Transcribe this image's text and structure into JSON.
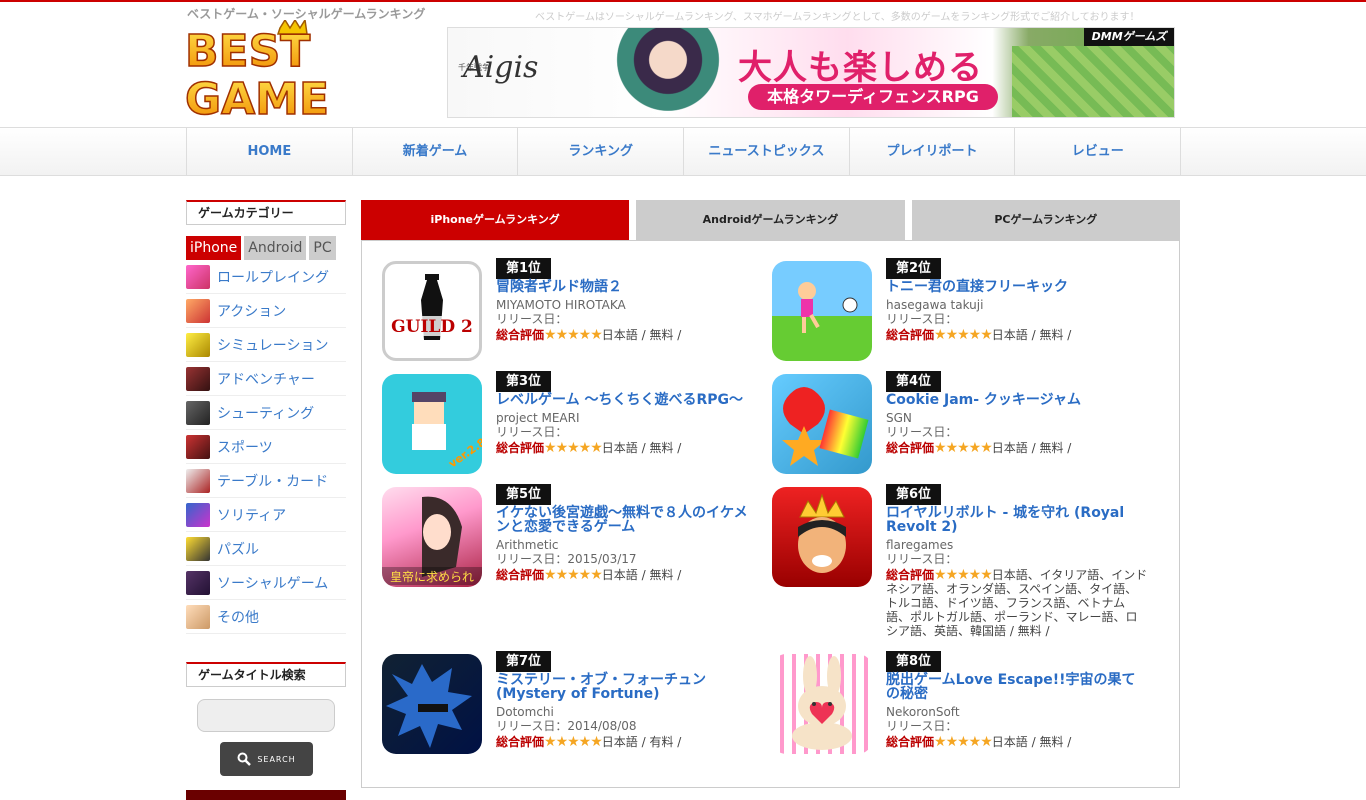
{
  "header": {
    "tagline": "ベストゲーム・ソーシャルゲームランキング",
    "subtagline": "ベストゲームはソーシャルゲームランキング、スマホゲームランキングとして、多数のゲームをランキング形式でご紹介しております！",
    "logo_line1": "BEST",
    "logo_line2": "GAME",
    "banner": {
      "title": "Aigis",
      "subtitle": "千年戦争",
      "copy1": "大人も楽しめる",
      "copy2": "本格タワーディフェンスRPG",
      "brand": "DMMゲームズ"
    }
  },
  "nav": [
    "HOME",
    "新着ゲーム",
    "ランキング",
    "ニューストピックス",
    "プレイリポート",
    "レビュー"
  ],
  "sidebar": {
    "category_heading": "ゲームカテゴリー",
    "platform_tabs": [
      "iPhone",
      "Android",
      "PC"
    ],
    "categories": [
      "ロールプレイング",
      "アクション",
      "シミュレーション",
      "アドベンチャー",
      "シューティング",
      "スポーツ",
      "テーブル・カード",
      "ソリティア",
      "パズル",
      "ソーシャルゲーム",
      "その他"
    ],
    "search_heading": "ゲームタイトル検索",
    "search_button": "SEARCH"
  },
  "main": {
    "tabs": [
      "iPhoneゲームランキング",
      "Androidゲームランキング",
      "PCゲームランキング"
    ],
    "rating_label": "総合評価",
    "stars": "★★★★★",
    "games": [
      {
        "rank": "第1位",
        "title": "冒険者ギルド物語２",
        "dev": "MIYAMOTO HIROTAKA",
        "release": "リリース日：",
        "langs": "日本語 / 無料 /"
      },
      {
        "rank": "第2位",
        "title": "トニー君の直接フリーキック",
        "dev": "hasegawa takuji",
        "release": "リリース日：",
        "langs": "日本語 / 無料 /"
      },
      {
        "rank": "第3位",
        "title": "レベルゲーム 〜ちくちく遊べるRPG〜",
        "dev": "project MEARI",
        "release": "リリース日：",
        "langs": "日本語 / 無料 /"
      },
      {
        "rank": "第4位",
        "title": "Cookie Jam- クッキージャム",
        "dev": "SGN",
        "release": "リリース日：",
        "langs": "日本語 / 無料 /"
      },
      {
        "rank": "第5位",
        "title": "イケない後宮遊戯〜無料で８人のイケメンと恋愛できるゲーム",
        "dev": "Arithmetic",
        "release": "リリース日：2015/03/17",
        "langs": "日本語 / 無料 /"
      },
      {
        "rank": "第6位",
        "title": "ロイヤルリボルト - 城を守れ (Royal Revolt 2)",
        "dev": "flaregames",
        "release": "リリース日：",
        "langs": "日本語、イタリア語、インドネシア語、オランダ語、スペイン語、タイ語、トルコ語、ドイツ語、フランス語、ベトナム語、ポルトガル語、ポーランド、マレー語、ロシア語、英語、韓国語 / 無料 /"
      },
      {
        "rank": "第7位",
        "title": "ミステリー・オブ・フォーチュン (Mystery of Fortune)",
        "dev": "Dotomchi",
        "release": "リリース日：2014/08/08",
        "langs": "日本語 / 有料 /"
      },
      {
        "rank": "第8位",
        "title": "脱出ゲームLove Escape!!宇宙の果ての秘密",
        "dev": "NekoronSoft",
        "release": "リリース日：",
        "langs": "日本語 / 無料 /"
      }
    ]
  }
}
